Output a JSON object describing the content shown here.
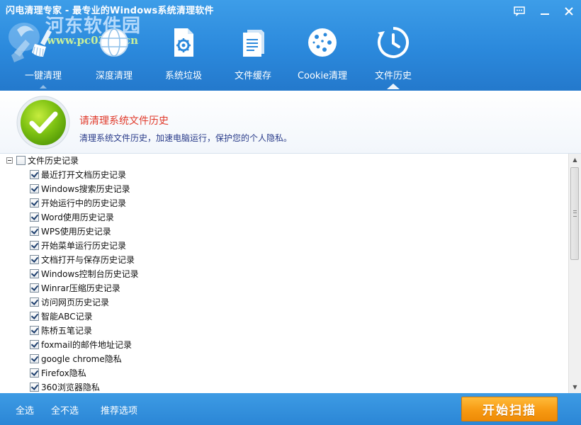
{
  "window": {
    "title": "闪电清理专家 - 最专业的Windows系统清理软件",
    "watermark_text": "河东软件园",
    "watermark_url": "www.pc0359.cn"
  },
  "tabs": [
    {
      "label": "一键清理",
      "icon": "broom-icon"
    },
    {
      "label": "深度清理",
      "icon": "globe-icon"
    },
    {
      "label": "系统垃圾",
      "icon": "gear-document-icon"
    },
    {
      "label": "文件缓存",
      "icon": "document-icon"
    },
    {
      "label": "Cookie清理",
      "icon": "cookie-icon"
    },
    {
      "label": "文件历史",
      "icon": "history-clock-icon",
      "active": true
    }
  ],
  "info": {
    "title": "请清理系统文件历史",
    "description": "清理系统文件历史，加速电脑运行，保护您的个人隐私。"
  },
  "tree": {
    "root": {
      "label": "文件历史记录",
      "checked": false,
      "expanded": true
    },
    "items": [
      {
        "label": "最近打开文档历史记录",
        "checked": true
      },
      {
        "label": "Windows搜索历史记录",
        "checked": true
      },
      {
        "label": "开始运行中的历史记录",
        "checked": true
      },
      {
        "label": "Word使用历史记录",
        "checked": true
      },
      {
        "label": "WPS使用历史记录",
        "checked": true
      },
      {
        "label": "开始菜单运行历史记录",
        "checked": true
      },
      {
        "label": "文档打开与保存历史记录",
        "checked": true
      },
      {
        "label": "Windows控制台历史记录",
        "checked": true
      },
      {
        "label": "Winrar压缩历史记录",
        "checked": true
      },
      {
        "label": "访问网页历史记录",
        "checked": true
      },
      {
        "label": "智能ABC记录",
        "checked": true
      },
      {
        "label": "陈桥五笔记录",
        "checked": true
      },
      {
        "label": "foxmail的邮件地址记录",
        "checked": true
      },
      {
        "label": "google chrome隐私",
        "checked": true
      },
      {
        "label": "Firefox隐私",
        "checked": true
      },
      {
        "label": "360浏览器隐私",
        "checked": true
      }
    ]
  },
  "footer": {
    "select_all": "全选",
    "select_none": "全不选",
    "recommended": "推荐选项",
    "scan_button": "开始扫描"
  },
  "colors": {
    "header_blue": "#2b89dc",
    "title_red": "#e0392a",
    "desc_blue": "#2a3c8a",
    "scan_orange": "#f79a12"
  }
}
